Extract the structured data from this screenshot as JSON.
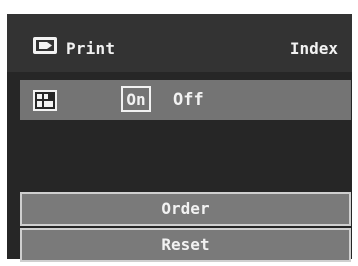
{
  "header": {
    "icon": "print-icon",
    "title": "Print",
    "right_label": "Index"
  },
  "setting_row": {
    "icon": "image-index-icon",
    "on_label": "On",
    "off_label": "Off",
    "selected": "On"
  },
  "buttons": {
    "order_label": "Order",
    "reset_label": "Reset"
  }
}
